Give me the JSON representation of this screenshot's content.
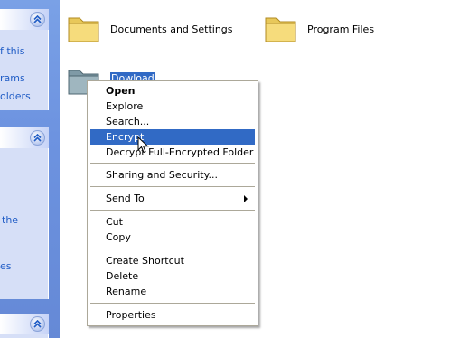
{
  "task_pane": {
    "panel1_links": [
      "f this",
      "rams",
      "olders"
    ],
    "panel2_links": [
      "the",
      "es"
    ]
  },
  "folders": [
    {
      "label": "Documents and Settings",
      "icon": "folder-icon"
    },
    {
      "label": "Program Files",
      "icon": "folder-icon"
    },
    {
      "label": "Dowload",
      "icon": "folder-icon",
      "selected": true
    }
  ],
  "context_menu": {
    "items": [
      {
        "label": "Open",
        "bold": true
      },
      {
        "label": "Explore"
      },
      {
        "label": "Search..."
      },
      {
        "label": "Encrypt",
        "highlighted": true
      },
      {
        "label": "Decrypt Full-Encrypted Folder"
      },
      {
        "label": "Sharing and Security..."
      },
      {
        "label": "Send To",
        "submenu": true
      },
      {
        "label": "Cut"
      },
      {
        "label": "Copy"
      },
      {
        "label": "Create Shortcut"
      },
      {
        "label": "Delete"
      },
      {
        "label": "Rename"
      },
      {
        "label": "Properties"
      }
    ]
  },
  "colors": {
    "highlight": "#316ac5",
    "link": "#215dc6",
    "task_pane": "#6d93e0",
    "panel": "#d6dff7"
  }
}
